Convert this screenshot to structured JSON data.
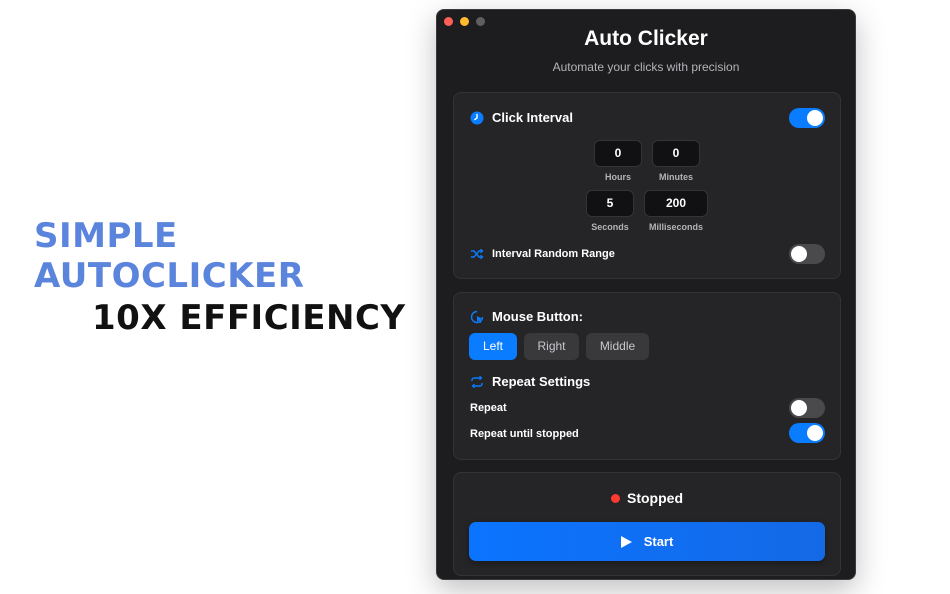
{
  "promo": {
    "headline": "SIMPLE AUTOCLICKER",
    "subheadline": "10X EFFICIENCY"
  },
  "window": {
    "title": "Auto Clicker",
    "subtitle": "Automate your clicks with precision"
  },
  "click_interval": {
    "title": "Click Interval",
    "icon": "clock-icon",
    "enabled": true,
    "fields": [
      {
        "value": "0",
        "label": "Hours"
      },
      {
        "value": "0",
        "label": "Minutes"
      },
      {
        "value": "5",
        "label": "Seconds"
      },
      {
        "value": "200",
        "label": "Milliseconds"
      }
    ],
    "random_range": {
      "label": "Interval Random Range",
      "icon": "shuffle-icon",
      "enabled": false
    }
  },
  "mouse_button": {
    "title": "Mouse Button:",
    "icon": "mouse-cursor-icon",
    "options": [
      "Left",
      "Right",
      "Middle"
    ],
    "selected": "Left"
  },
  "repeat_settings": {
    "title": "Repeat Settings",
    "icon": "repeat-icon",
    "repeat": {
      "label": "Repeat",
      "enabled": false
    },
    "repeat_until_stopped": {
      "label": "Repeat until stopped",
      "enabled": true
    }
  },
  "status": {
    "text": "Stopped",
    "color": "#ff3b30"
  },
  "start_button": {
    "label": "Start",
    "icon": "play-icon"
  },
  "colors": {
    "accent": "#0a7cff",
    "promo_blue": "#5b85dc",
    "window_bg": "#1d1d1f",
    "card_bg": "#252527"
  }
}
